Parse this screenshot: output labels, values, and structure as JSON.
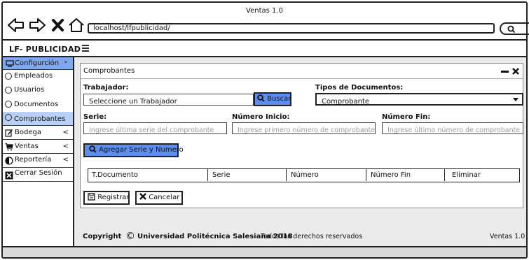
{
  "browser": {
    "window_title": "Ventas 1.0",
    "url": "localhost/lfpublicidad/",
    "search_hint": "q"
  },
  "app": {
    "brand": "LF- PUBLICIDAD",
    "menu_icon": "hamburger-icon"
  },
  "sidebar": {
    "config": {
      "label": "Configurción",
      "icon": "monitor-icon",
      "caret": "⌄"
    },
    "sub_items": [
      {
        "label": "Empleados"
      },
      {
        "label": "Usuarios"
      },
      {
        "label": "Documentos"
      },
      {
        "label": "Comprobantes"
      }
    ],
    "items": [
      {
        "label": "Bodega",
        "icon": "edit-icon",
        "caret": "<"
      },
      {
        "label": "Ventas",
        "icon": "cart-icon",
        "caret": "<"
      },
      {
        "label": "Reportería",
        "icon": "pie-icon",
        "caret": "<"
      },
      {
        "label": "Cerrar Sesión",
        "icon": "close-box-icon"
      }
    ]
  },
  "panel": {
    "title": "Comprobantes",
    "trabajador_label": "Trabajador:",
    "trabajador_value": "Seleccione un Trabajador",
    "buscar_label": "Buscar",
    "tipos_label": "Tipos de Documentos:",
    "tipos_value": "Comprobante",
    "serie_label": "Serie:",
    "serie_placeholder": "Ingrese última serie del comprobante",
    "inicio_label": "Número Inicio:",
    "inicio_placeholder": "Ingrese primero número de comprobante",
    "fin_label": "Número Fin:",
    "fin_placeholder": "Ingrese último número de comprobante",
    "agregar_label": "Agregar Serie y Numero",
    "table_headers": [
      "T.Documento",
      "Serie",
      "Número",
      "Número Fin",
      "Eliminar"
    ],
    "registrar_label": "Registrar",
    "cancelar_label": "Cancelar"
  },
  "footer": {
    "copyright_prefix": "Copyright",
    "copyright_symbol": "©",
    "org": "Universidad Politécnica Salesiana 2018",
    "rights": "Todos los derechos reservados",
    "version": "Ventas 1.0"
  },
  "colors": {
    "accent_blue": "#5b8ef0",
    "selected_item": "#b8d0f5",
    "background_gray": "#ebebeb"
  }
}
